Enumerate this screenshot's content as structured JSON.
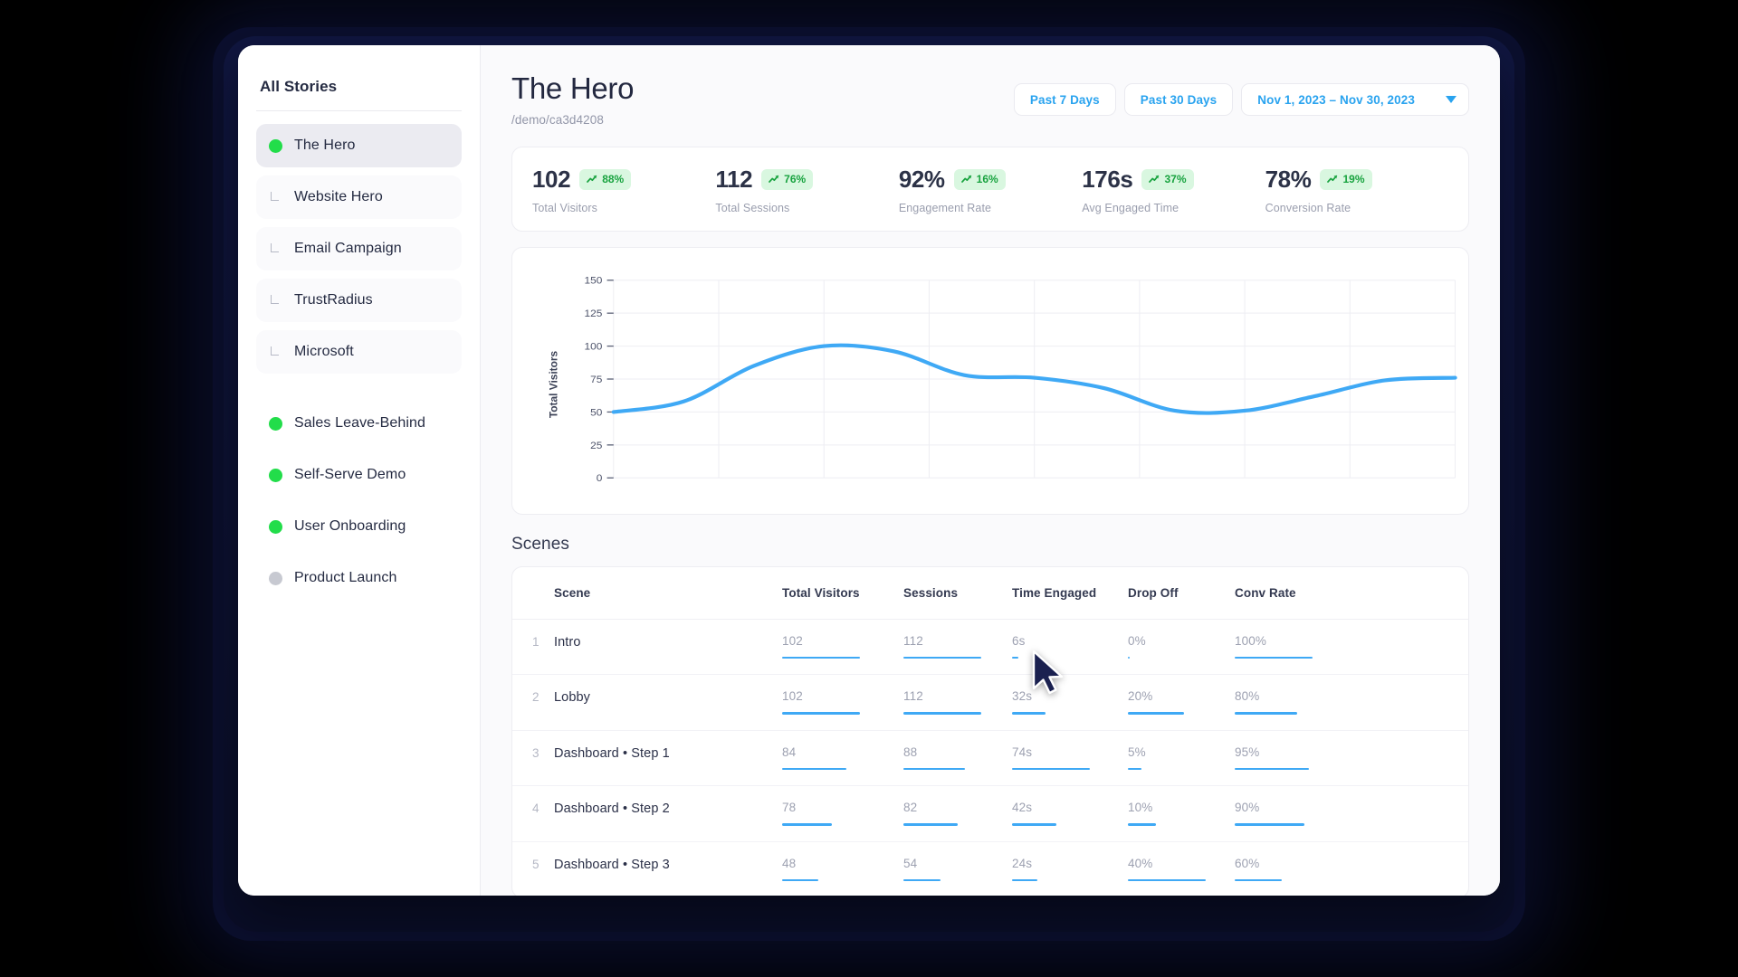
{
  "sidebar": {
    "title": "All Stories",
    "items": [
      {
        "label": "The Hero",
        "marker": "green-dot",
        "state": "active"
      },
      {
        "label": "Website Hero",
        "marker": "child-glyph",
        "state": "child"
      },
      {
        "label": "Email Campaign",
        "marker": "child-glyph",
        "state": "child"
      },
      {
        "label": "TrustRadius",
        "marker": "child-glyph",
        "state": "child"
      },
      {
        "label": "Microsoft",
        "marker": "child-glyph",
        "state": "child"
      },
      {
        "label": "Sales Leave-Behind",
        "marker": "green-dot",
        "state": "plain"
      },
      {
        "label": "Self-Serve Demo",
        "marker": "green-dot",
        "state": "plain"
      },
      {
        "label": "User Onboarding",
        "marker": "green-dot",
        "state": "plain"
      },
      {
        "label": "Product Launch",
        "marker": "grey-dot",
        "state": "plain"
      }
    ]
  },
  "header": {
    "title": "The Hero",
    "url": "/demo/ca3d4208",
    "buttons": [
      {
        "label": "Past 7 Days"
      },
      {
        "label": "Past 30 Days"
      }
    ],
    "date_range": "Nov 1, 2023 – Nov 30, 2023",
    "caret_icon": "chevron-down-icon"
  },
  "kpis": [
    {
      "value": "102",
      "delta": "88%",
      "label": "Total Visitors",
      "trend": "trend-up-icon"
    },
    {
      "value": "112",
      "delta": "76%",
      "label": "Total Sessions",
      "trend": "trend-up-icon"
    },
    {
      "value": "92%",
      "delta": "16%",
      "label": "Engagement Rate",
      "trend": "trend-up-icon"
    },
    {
      "value": "176s",
      "delta": "37%",
      "label": "Avg Engaged Time",
      "trend": "trend-up-icon"
    },
    {
      "value": "78%",
      "delta": "19%",
      "label": "Conversion Rate",
      "trend": "trend-up-icon"
    }
  ],
  "chart_data": {
    "type": "line",
    "title": "",
    "xlabel": "",
    "ylabel": "Total Visitors",
    "ylim": [
      0,
      150
    ],
    "yticks": [
      0,
      25,
      50,
      75,
      100,
      125,
      150
    ],
    "grid": true,
    "legend": "none",
    "line_color": "#3fa9f5",
    "x": [
      0,
      1,
      2,
      3,
      4,
      5,
      6,
      7,
      8,
      9,
      10,
      11,
      12
    ],
    "values": [
      50,
      58,
      85,
      100,
      96,
      78,
      76,
      68,
      51,
      51,
      62,
      74,
      76
    ]
  },
  "scenes": {
    "heading": "Scenes",
    "columns": [
      "Scene",
      "Total Visitors",
      "Sessions",
      "Time Engaged",
      "Drop Off",
      "Conv Rate"
    ],
    "rows": [
      {
        "index": "1",
        "scene": "Intro",
        "total_visitors": "102",
        "tv_pct": 100,
        "sessions": "112",
        "se_pct": 100,
        "time_engaged": "6s",
        "te_pct": 8,
        "drop_off": "0%",
        "do_pct": 2,
        "conv_rate": "100%",
        "cr_pct": 100
      },
      {
        "index": "2",
        "scene": "Lobby",
        "total_visitors": "102",
        "tv_pct": 100,
        "sessions": "112",
        "se_pct": 100,
        "time_engaged": "32s",
        "te_pct": 43,
        "drop_off": "20%",
        "do_pct": 72,
        "conv_rate": "80%",
        "cr_pct": 80
      },
      {
        "index": "3",
        "scene": "Dashboard • Step 1",
        "total_visitors": "84",
        "tv_pct": 82,
        "sessions": "88",
        "se_pct": 79,
        "time_engaged": "74s",
        "te_pct": 100,
        "drop_off": "5%",
        "do_pct": 18,
        "conv_rate": "95%",
        "cr_pct": 95
      },
      {
        "index": "4",
        "scene": "Dashboard • Step 2",
        "total_visitors": "78",
        "tv_pct": 64,
        "sessions": "82",
        "se_pct": 70,
        "time_engaged": "42s",
        "te_pct": 57,
        "drop_off": "10%",
        "do_pct": 36,
        "conv_rate": "90%",
        "cr_pct": 90
      },
      {
        "index": "5",
        "scene": "Dashboard • Step 3",
        "total_visitors": "48",
        "tv_pct": 47,
        "sessions": "54",
        "se_pct": 48,
        "time_engaged": "24s",
        "te_pct": 32,
        "drop_off": "40%",
        "do_pct": 100,
        "conv_rate": "60%",
        "cr_pct": 60
      }
    ]
  },
  "cursor": {
    "icon": "mouse-pointer-icon"
  },
  "colors": {
    "accent_blue": "#29a3ef",
    "chart_blue": "#3fa9f5",
    "badge_green": "#18a33f",
    "badge_bg": "#d9f7e0",
    "status_green": "#22dd4a",
    "status_grey": "#c7c9d1",
    "frame_navy": "#0b0f2e"
  }
}
